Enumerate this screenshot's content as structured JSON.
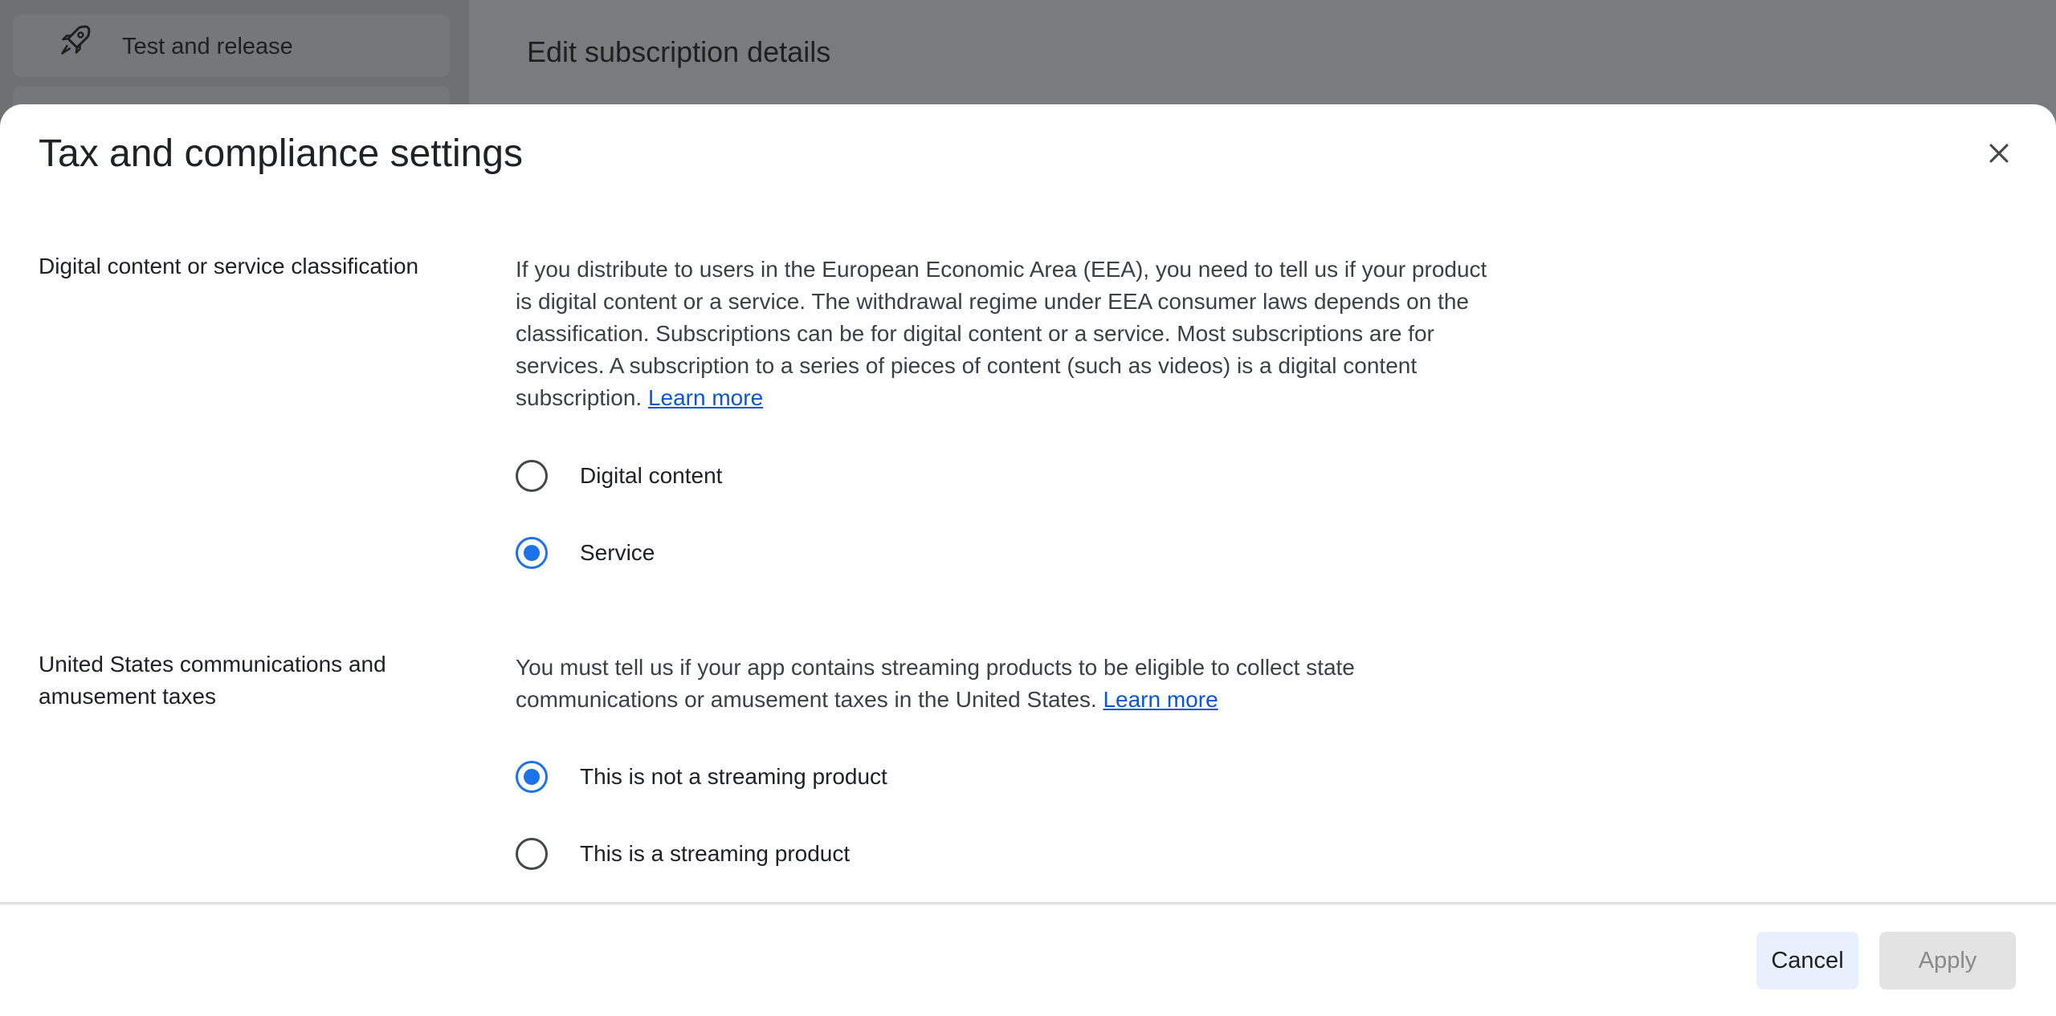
{
  "background": {
    "sidebar_item_label": "Test and release",
    "page_title": "Edit subscription details"
  },
  "dialog": {
    "title": "Tax and compliance settings",
    "close_icon": "close-icon",
    "sections": [
      {
        "label": "Digital content or service classification",
        "description": "If you distribute to users in the European Economic Area (EEA), you need to tell us if your product is digital content or a service. The withdrawal regime under EEA consumer laws depends on the classification. Subscriptions can be for digital content or a service. Most subscriptions are for services. A subscription to a series of pieces of content (such as videos) is a digital content subscription.",
        "learn_more": "Learn more",
        "options": [
          {
            "label": "Digital content",
            "checked": false
          },
          {
            "label": "Service",
            "checked": true
          }
        ]
      },
      {
        "label": "United States communications and amusement taxes",
        "description": "You must tell us if your app contains streaming products to be eligible to collect state communications or amusement taxes in the United States.",
        "learn_more": "Learn more",
        "options": [
          {
            "label": "This is not a streaming product",
            "checked": true
          },
          {
            "label": "This is a streaming product",
            "checked": false
          }
        ]
      }
    ],
    "footer": {
      "cancel_label": "Cancel",
      "apply_label": "Apply",
      "apply_enabled": false
    }
  },
  "colors": {
    "accent": "#1a73e8",
    "link": "#0b57d0",
    "backdrop": "#7a7b7e",
    "cancel_bg": "#e8f0fe",
    "apply_disabled_bg": "#e3e3e3"
  }
}
